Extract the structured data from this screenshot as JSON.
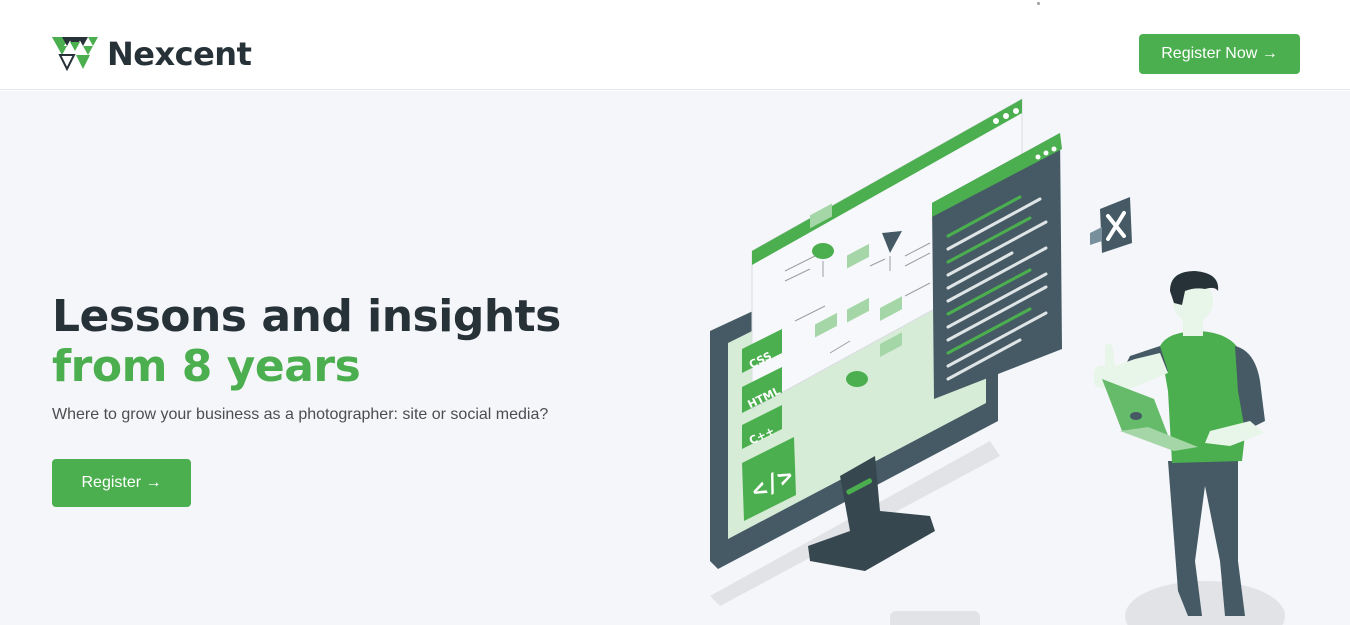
{
  "brand": {
    "name": "Nexcent",
    "logo_icon": "nexcent-logo-icon",
    "accent_color": "#4caf4f",
    "text_color": "#263238"
  },
  "navbar": {
    "cta_label": "Register Now →"
  },
  "hero": {
    "headline_line1": "Lessons and insights",
    "headline_line2": "from 8 years",
    "subtitle": "Where to grow your business as a photographer: site or social media?",
    "cta_label": "Register →",
    "background_color": "#f5f6fa",
    "illustration": {
      "icon": "developer-illustration",
      "code_badges": [
        "CSS",
        "HTML",
        "C++"
      ],
      "code_symbol": "</>"
    }
  }
}
